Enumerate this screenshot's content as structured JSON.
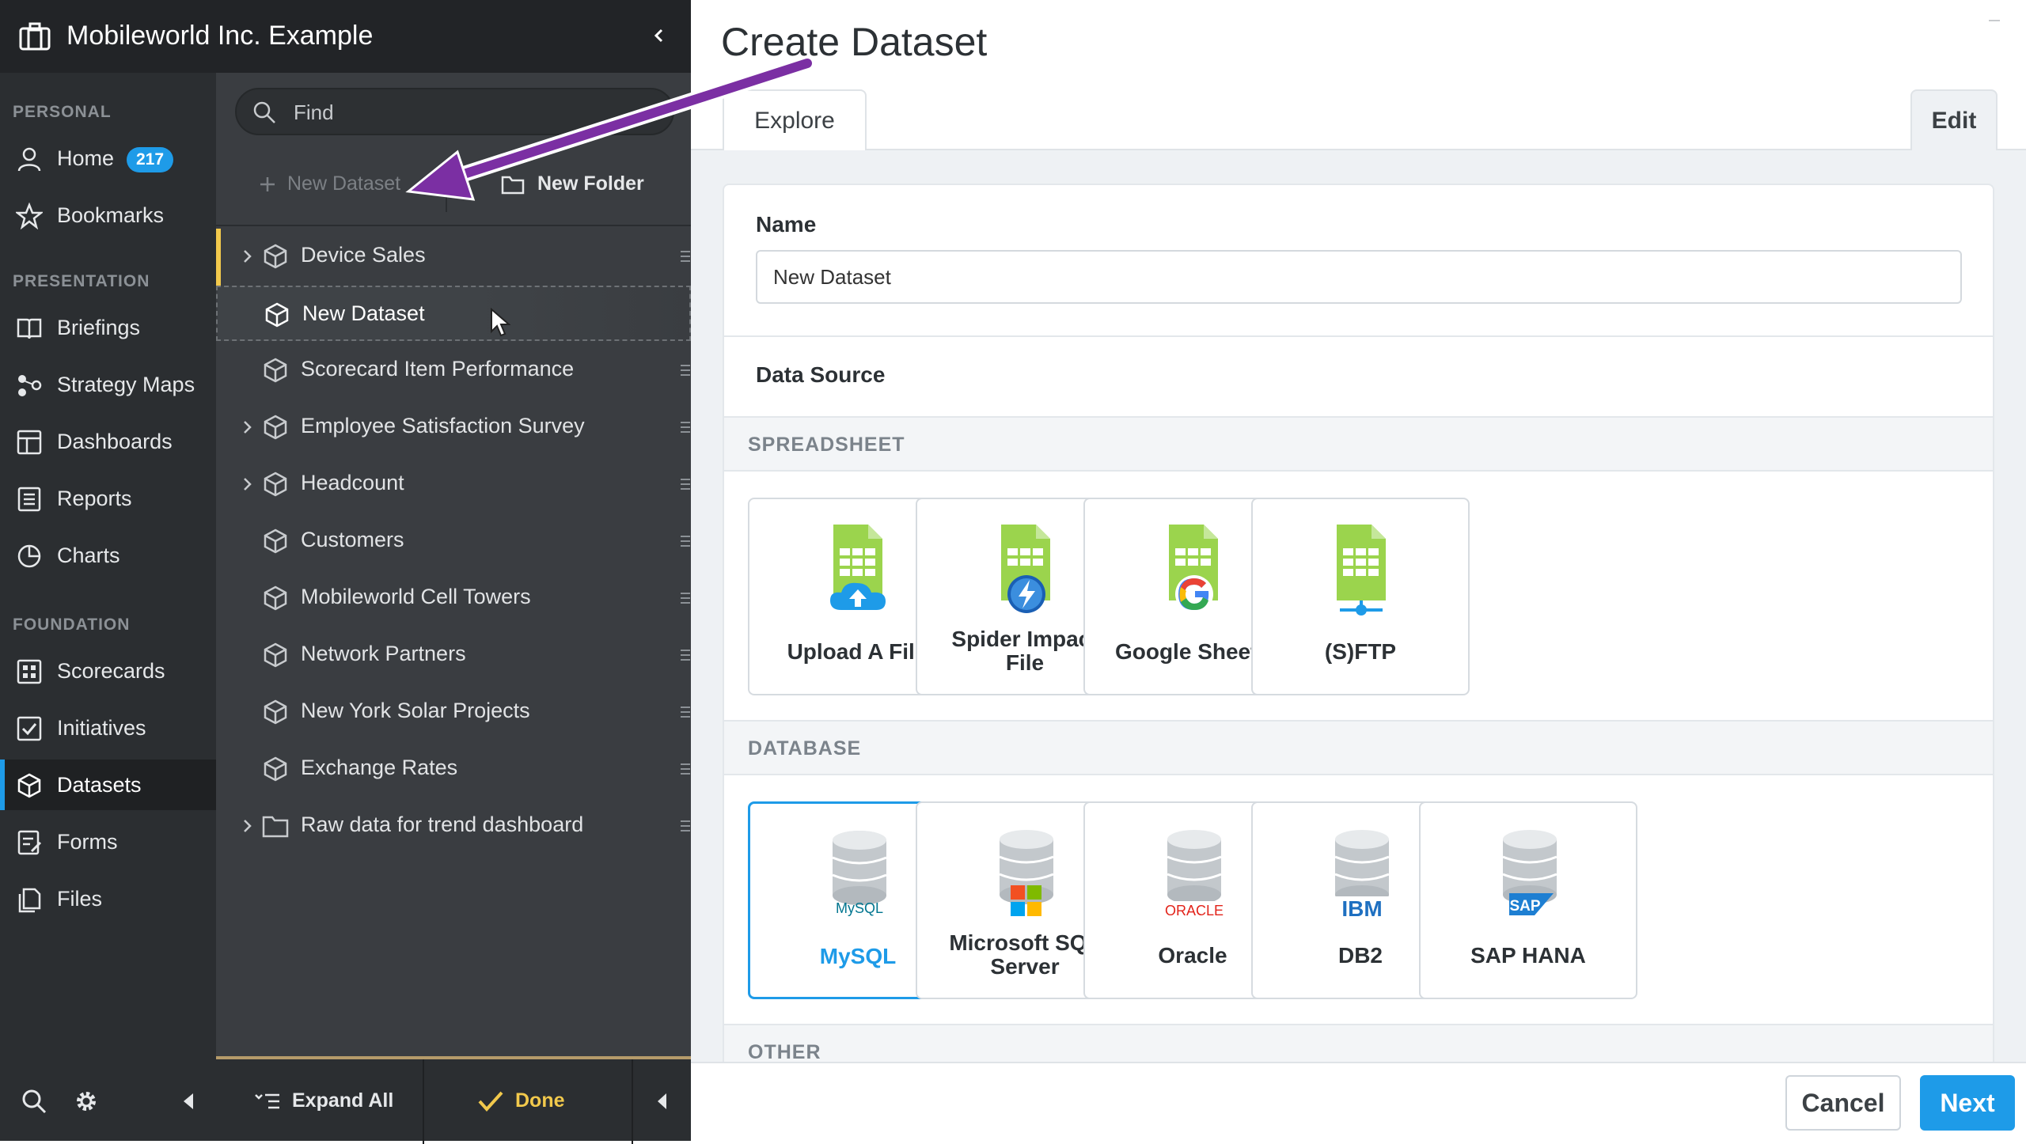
{
  "header": {
    "org_name": "Mobileworld Inc. Example"
  },
  "leftnav": {
    "sections": {
      "personal": "PERSONAL",
      "presentation": "PRESENTATION",
      "foundation": "FOUNDATION"
    },
    "home": {
      "label": "Home",
      "badge": "217"
    },
    "bookmarks": "Bookmarks",
    "briefings": "Briefings",
    "strategy_maps": "Strategy Maps",
    "dashboards": "Dashboards",
    "reports": "Reports",
    "charts": "Charts",
    "scorecards": "Scorecards",
    "initiatives": "Initiatives",
    "datasets": "Datasets",
    "forms": "Forms",
    "files": "Files"
  },
  "midpanel": {
    "search_placeholder": "Find",
    "new_dataset": "New Dataset",
    "new_folder": "New Folder",
    "items": [
      {
        "label": "Device Sales"
      },
      {
        "label": "New Dataset"
      },
      {
        "label": "Scorecard Item Performance"
      },
      {
        "label": "Employee Satisfaction Survey"
      },
      {
        "label": "Headcount"
      },
      {
        "label": "Customers"
      },
      {
        "label": "Mobileworld Cell Towers"
      },
      {
        "label": "Network Partners"
      },
      {
        "label": "New York Solar Projects"
      },
      {
        "label": "Exchange Rates"
      },
      {
        "label": "Raw data for trend dashboard"
      }
    ],
    "expand_all": "Expand All",
    "done": "Done"
  },
  "main": {
    "title": "Create Dataset",
    "tabs": {
      "explore": "Explore",
      "edit": "Edit"
    },
    "name_label": "Name",
    "name_value": "New Dataset",
    "data_source_label": "Data Source",
    "groups": {
      "spreadsheet": "SPREADSHEET",
      "database": "DATABASE",
      "other": "OTHER"
    },
    "spreadsheet_tiles": {
      "upload": "Upload A File",
      "spider_1": "Spider Impact",
      "spider_2": "File",
      "google": "Google Sheets",
      "ftp": "(S)FTP"
    },
    "database_tiles": {
      "mysql": "MySQL",
      "mssql_1": "Microsoft SQL",
      "mssql_2": "Server",
      "oracle": "Oracle",
      "db2": "DB2",
      "sap": "SAP HANA"
    },
    "logo_text": {
      "mysql": "MySQL",
      "oracle": "ORACLE",
      "ibm": "IBM",
      "sap": "SAP"
    },
    "cancel": "Cancel",
    "next": "Next"
  },
  "colors": {
    "accent": "#1e9be8",
    "highlight": "#f2c94c",
    "arrow": "#7b2fa3"
  }
}
